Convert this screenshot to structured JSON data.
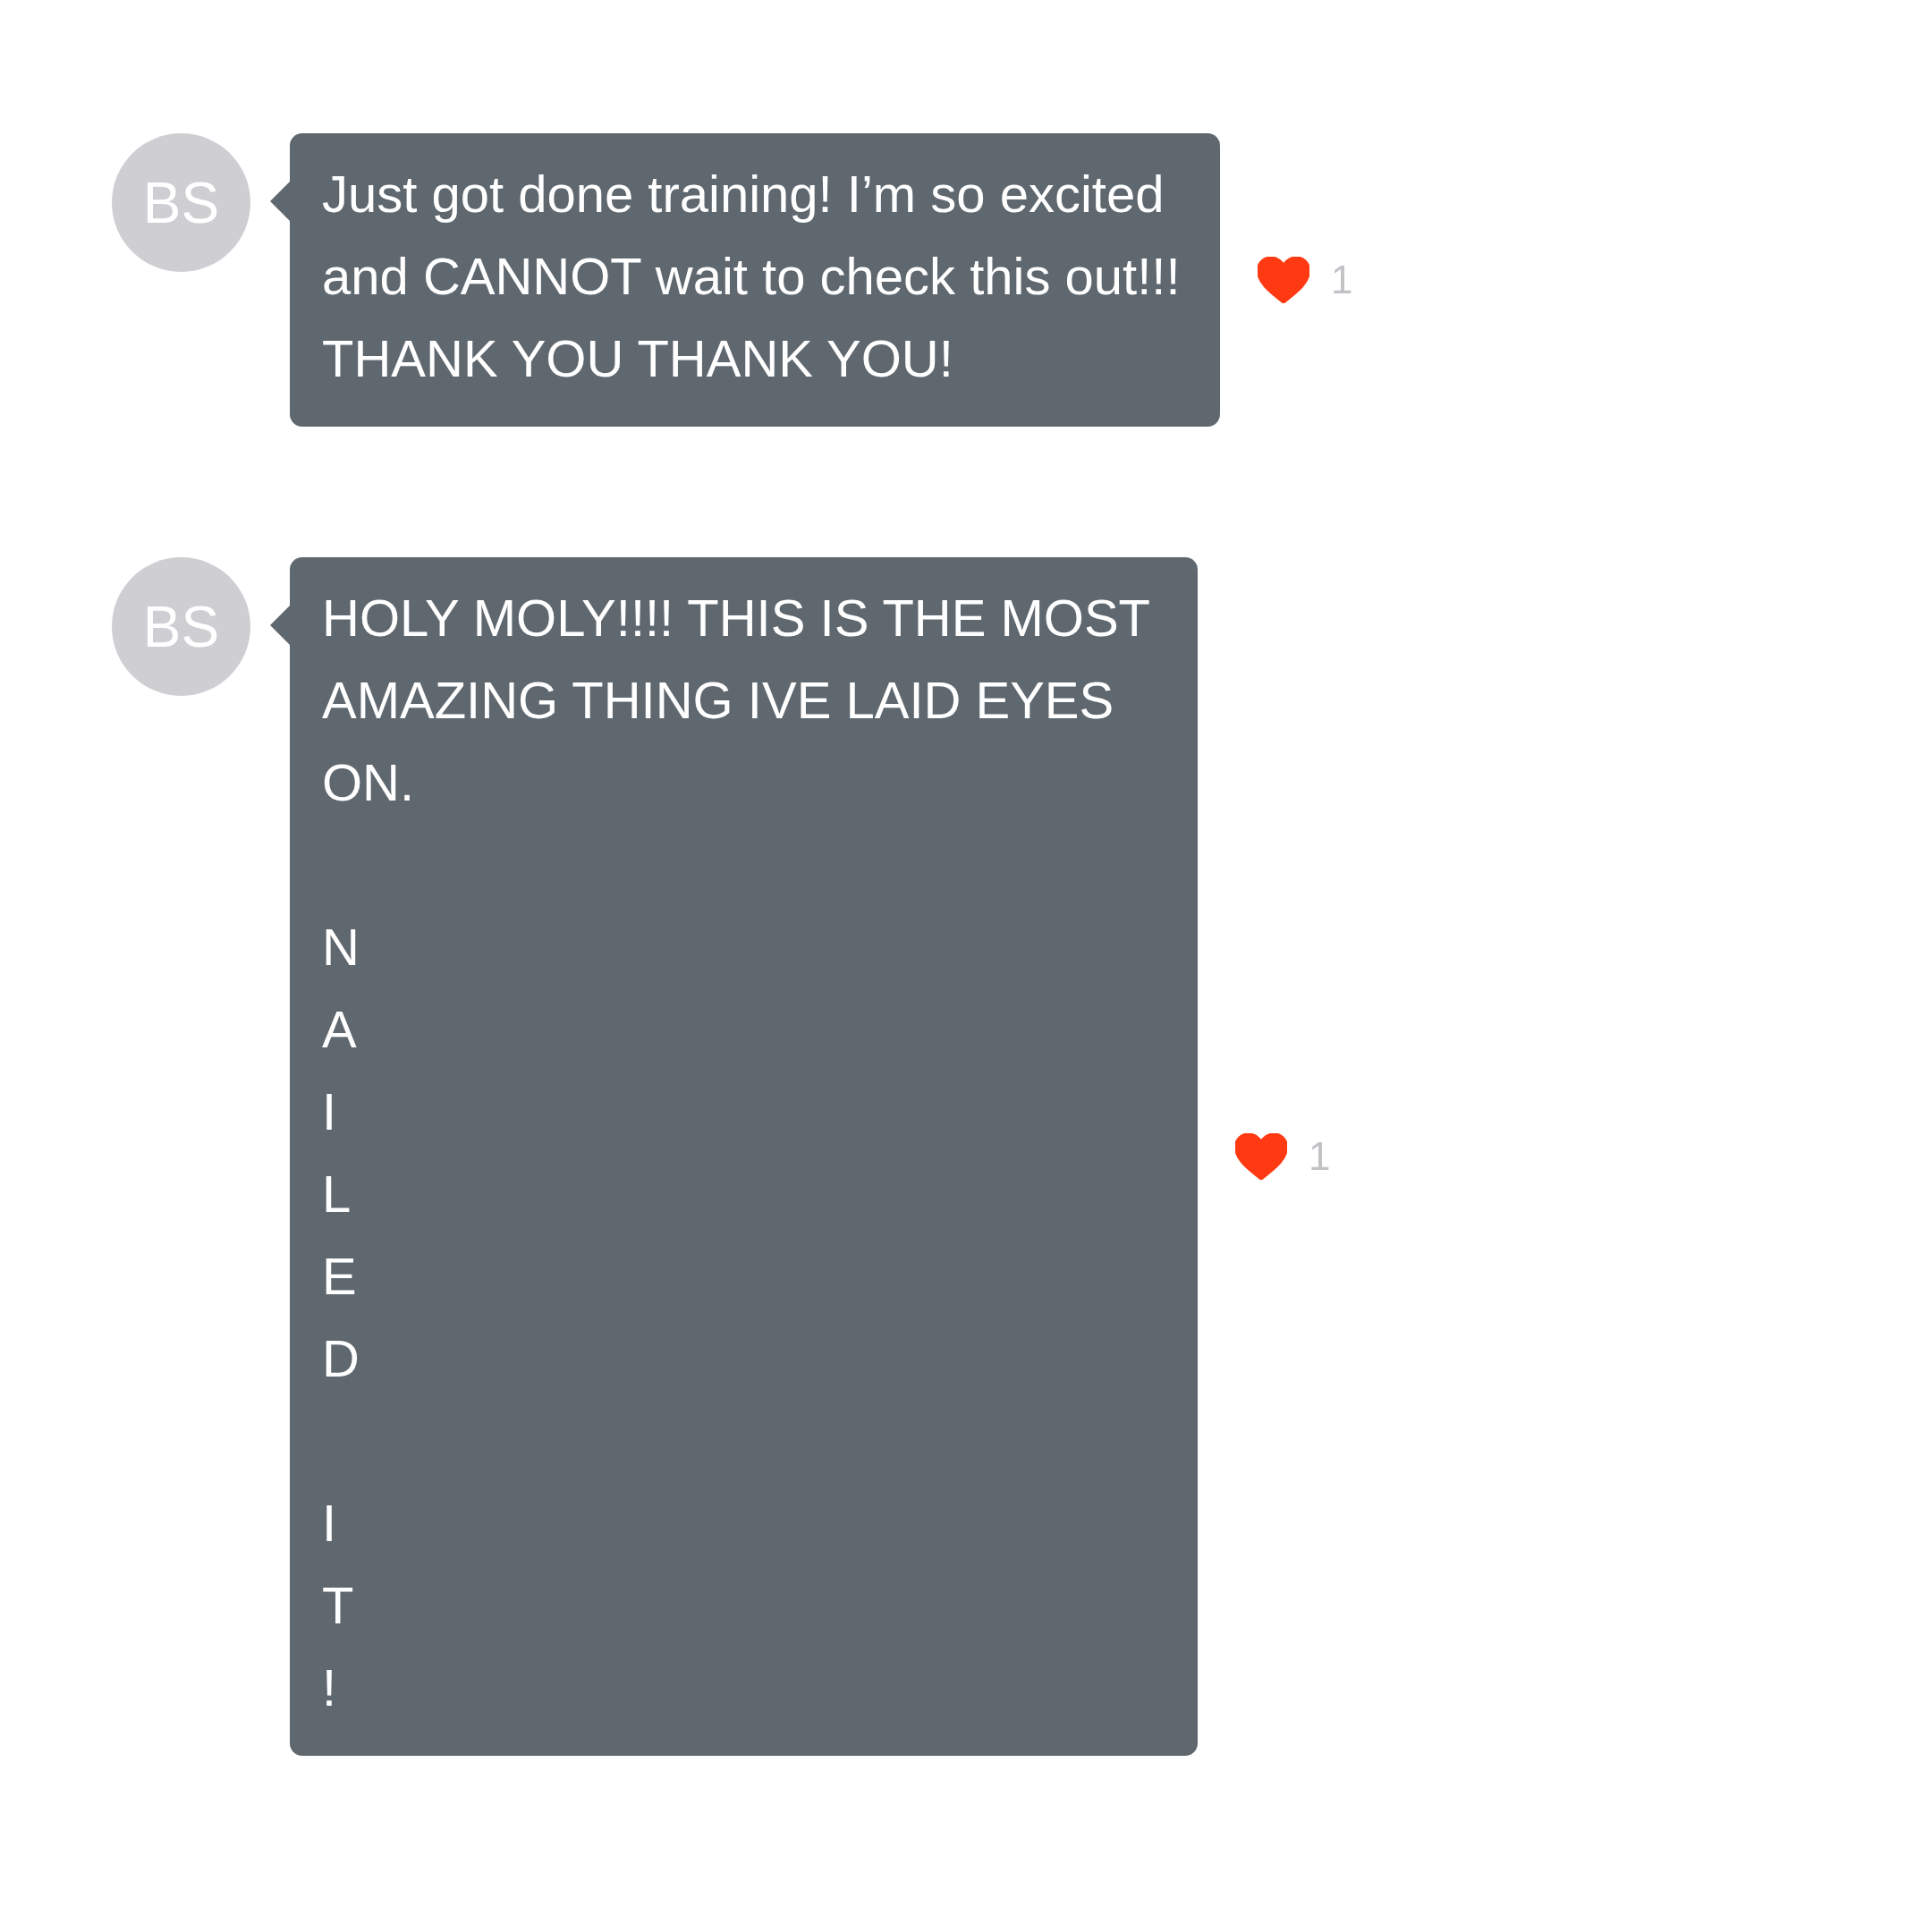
{
  "messages": [
    {
      "avatar": "BS",
      "text": "Just got done training! I’m so excited and CANNOT wait to check this out!!! THANK YOU THANK YOU!",
      "liked": true,
      "like_count": "1"
    },
    {
      "avatar": "BS",
      "text": "HOLY MOLY!!!! THIS IS THE MOST AMAZING THING IVE LAID EYES ON.\n\nN\nA\nI\nL\nE\nD\n\nI\nT\n!",
      "liked": true,
      "like_count": "1"
    }
  ]
}
